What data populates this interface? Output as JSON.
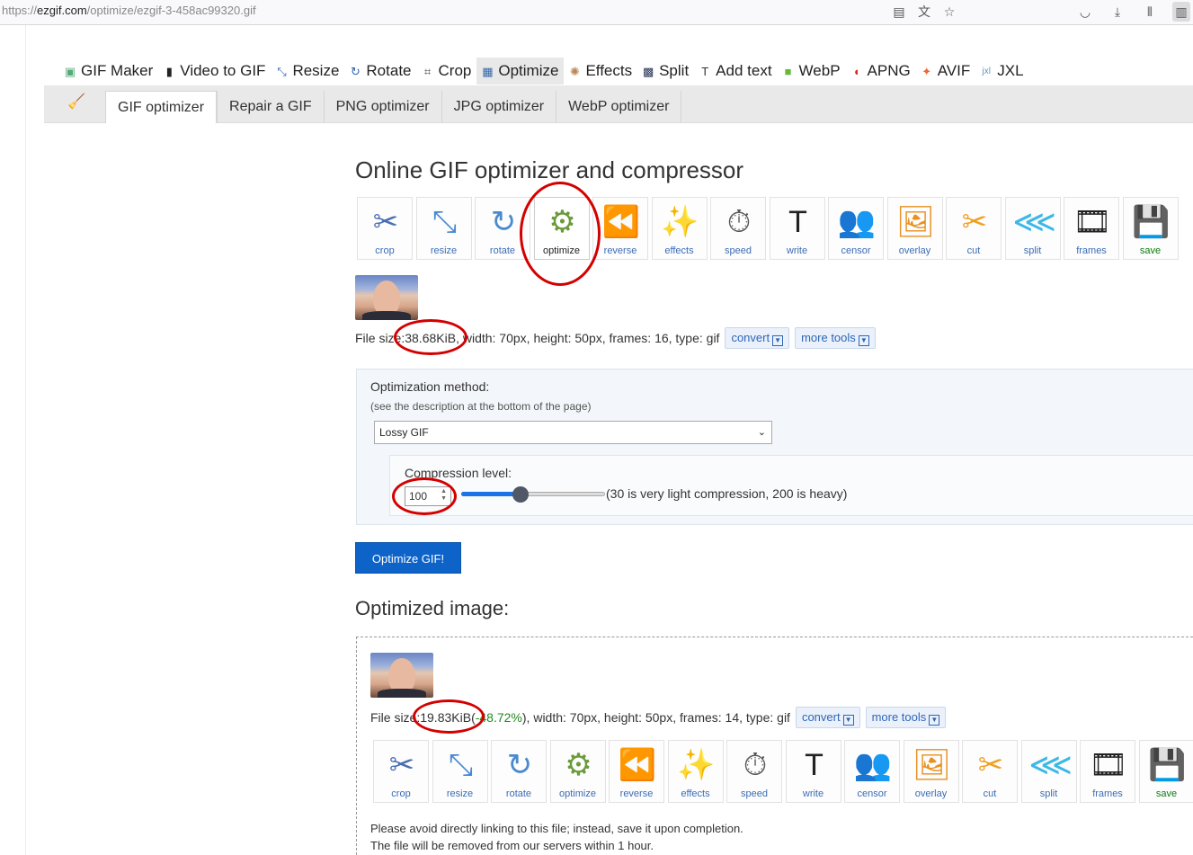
{
  "browser": {
    "url_prefix": "https://",
    "url_host": "ezgif.com",
    "url_path": "/optimize/ezgif-3-458ac99320.gif"
  },
  "main_nav": [
    {
      "label": "GIF Maker",
      "icon": "gif-maker-icon"
    },
    {
      "label": "Video to GIF",
      "icon": "film-icon"
    },
    {
      "label": "Resize",
      "icon": "resize-icon"
    },
    {
      "label": "Rotate",
      "icon": "rotate-icon"
    },
    {
      "label": "Crop",
      "icon": "crop-icon"
    },
    {
      "label": "Optimize",
      "icon": "optimize-icon",
      "active": true
    },
    {
      "label": "Effects",
      "icon": "palette-icon"
    },
    {
      "label": "Split",
      "icon": "split-icon"
    },
    {
      "label": "Add text",
      "icon": "text-icon"
    },
    {
      "label": "WebP",
      "icon": "webp-icon"
    },
    {
      "label": "APNG",
      "icon": "apng-icon"
    },
    {
      "label": "AVIF",
      "icon": "avif-icon"
    },
    {
      "label": "JXL",
      "icon": "jxl-icon"
    }
  ],
  "sub_nav": [
    "GIF optimizer",
    "Repair a GIF",
    "PNG optimizer",
    "JPG optimizer",
    "WebP optimizer"
  ],
  "page_title": "Online GIF optimizer and compressor",
  "tools": [
    {
      "label": "crop",
      "icon": "crop-tool-icon"
    },
    {
      "label": "resize",
      "icon": "resize-tool-icon"
    },
    {
      "label": "rotate",
      "icon": "rotate-tool-icon"
    },
    {
      "label": "optimize",
      "icon": "optimize-tool-icon"
    },
    {
      "label": "reverse",
      "icon": "reverse-tool-icon"
    },
    {
      "label": "effects",
      "icon": "effects-tool-icon"
    },
    {
      "label": "speed",
      "icon": "speed-tool-icon"
    },
    {
      "label": "write",
      "icon": "write-tool-icon"
    },
    {
      "label": "censor",
      "icon": "censor-tool-icon"
    },
    {
      "label": "overlay",
      "icon": "overlay-tool-icon"
    },
    {
      "label": "cut",
      "icon": "cut-tool-icon"
    },
    {
      "label": "split",
      "icon": "split-tool-icon"
    },
    {
      "label": "frames",
      "icon": "frames-tool-icon"
    },
    {
      "label": "save",
      "icon": "save-tool-icon"
    }
  ],
  "original": {
    "size_label": "File size: ",
    "size": "38.68KiB",
    "details": ", width: 70px, height: 50px, frames: 16, type: gif"
  },
  "buttons": {
    "convert": "convert",
    "more_tools": "more tools",
    "optimize": "Optimize GIF!"
  },
  "options": {
    "method_label": "Optimization method:",
    "method_note": "(see the description at the bottom of the page)",
    "method_value": "Lossy GIF",
    "compression_label": "Compression level:",
    "compression_value": "100",
    "compression_min": 30,
    "compression_max": 200,
    "compression_hint": "(30 is very light compression, 200 is heavy)"
  },
  "result": {
    "title": "Optimized image:",
    "size_label": "File size: ",
    "size": "19.83KiB",
    "percent_open": " (",
    "percent": "-48.72%",
    "details": "), width: 70px, height: 50px, frames: 14, type: gif",
    "notice_1": "Please avoid directly linking to this file; instead, save it upon completion.",
    "notice_2": "The file will be removed from our servers within 1 hour."
  },
  "colors": {
    "accent": "#0d63c8",
    "highlight": "#d40000",
    "saving": "#1f8b1f"
  }
}
